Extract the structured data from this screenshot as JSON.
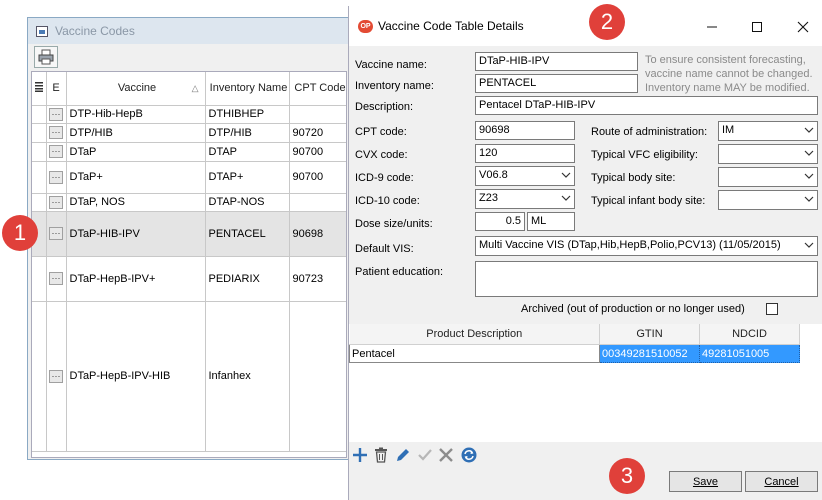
{
  "left_window": {
    "title": "Vaccine Codes",
    "columns": {
      "e": "E",
      "vaccine": "Vaccine",
      "sort_indicator": "△",
      "inventory_name": "Inventory Name",
      "cpt_code": "CPT Code"
    },
    "rows": [
      {
        "vaccine": "DTP-Hib-HepB",
        "inventory": "DTHIBHEP",
        "cpt": ""
      },
      {
        "vaccine": "DTP/HIB",
        "inventory": "DTP/HIB",
        "cpt": "90720"
      },
      {
        "vaccine": "DTaP",
        "inventory": "DTAP",
        "cpt": "90700"
      },
      {
        "vaccine": "DTaP+",
        "inventory": "DTAP+",
        "cpt": "90700"
      },
      {
        "vaccine": "DTaP, NOS",
        "inventory": "DTAP-NOS",
        "cpt": ""
      },
      {
        "vaccine": "DTaP-HIB-IPV",
        "inventory": "PENTACEL",
        "cpt": "90698"
      },
      {
        "vaccine": "DTaP-HepB-IPV+",
        "inventory": "PEDIARIX",
        "cpt": "90723"
      },
      {
        "vaccine": "DTaP-HepB-IPV-HIB",
        "inventory": "Infanhex",
        "cpt": ""
      }
    ],
    "row_button_label": "···"
  },
  "dialog": {
    "title": "Vaccine Code Table Details",
    "app_logo_text": "OP",
    "labels": {
      "vaccine_name": "Vaccine name:",
      "inventory_name": "Inventory name:",
      "description": "Description:",
      "cpt_code": "CPT code:",
      "cvx_code": "CVX code:",
      "icd9_code": "ICD-9 code:",
      "icd10_code": "ICD-10 code:",
      "dose_size": "Dose size/units:",
      "default_vis": "Default VIS:",
      "patient_education": "Patient education:",
      "route": "Route of administration:",
      "vfc": "Typical VFC eligibility:",
      "body_site": "Typical body site:",
      "infant_body_site": "Typical infant body site:",
      "archived": "Archived (out of production or no longer used)"
    },
    "values": {
      "vaccine_name": "DTaP-HIB-IPV",
      "inventory_name": "PENTACEL",
      "description": "Pentacel DTaP-HIB-IPV",
      "cpt_code": "90698",
      "cvx_code": "120",
      "icd9_code": "V06.8",
      "icd10_code": "Z23",
      "dose_size": "0.5",
      "dose_units": "ML",
      "default_vis": "Multi Vaccine VIS (DTap,Hib,HepB,Polio,PCV13) (11/05/2015)",
      "patient_education": "",
      "route": "IM",
      "vfc": "",
      "body_site": "",
      "infant_body_site": "",
      "archived": false
    },
    "note_lines": [
      "To ensure consistent forecasting,",
      "vaccine name cannot be changed.",
      "Inventory name MAY be modified."
    ],
    "products": {
      "columns": [
        "Product Description",
        "GTIN",
        "NDCID"
      ],
      "rows": [
        {
          "description": "Pentacel",
          "gtin": "00349281510052",
          "ndcid": "49281051005"
        }
      ]
    },
    "toolbar_icons": [
      "add-icon",
      "delete-icon",
      "edit-icon",
      "check-icon",
      "cancel-icon",
      "refresh-icon"
    ],
    "buttons": {
      "save": "Save",
      "cancel": "Cancel"
    }
  },
  "markers": [
    "1",
    "2",
    "3"
  ],
  "colors": {
    "marker": "#e0403a",
    "selection": "#3399ff",
    "toolbar_icon": "#2f6fb5"
  }
}
